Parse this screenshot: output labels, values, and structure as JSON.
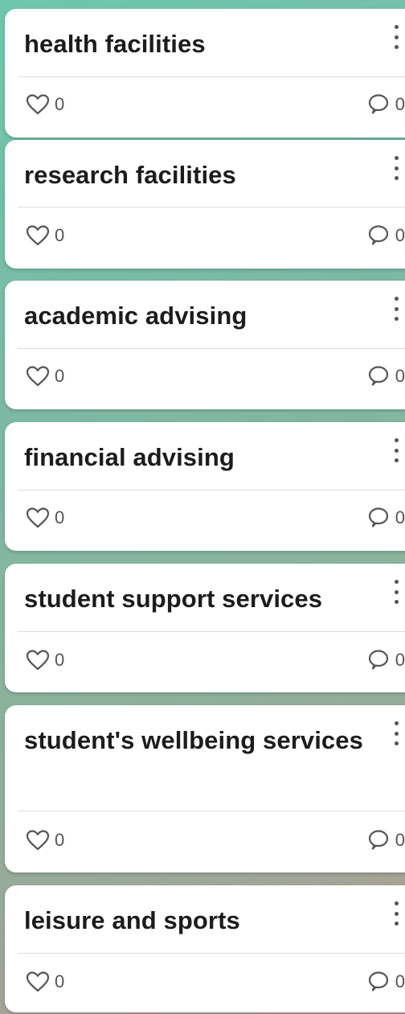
{
  "cards": [
    {
      "title": "health facilities",
      "likes": "0",
      "comments": "0"
    },
    {
      "title": "research facilities",
      "likes": "0",
      "comments": "0"
    },
    {
      "title": "academic advising",
      "likes": "0",
      "comments": "0"
    },
    {
      "title": "financial advising",
      "likes": "0",
      "comments": "0"
    },
    {
      "title": "student support services",
      "likes": "0",
      "comments": "0"
    },
    {
      "title": "student's wellbeing services",
      "likes": "0",
      "comments": "0"
    },
    {
      "title": "leisure and sports",
      "likes": "0",
      "comments": "0"
    }
  ],
  "icons": {
    "like": "heart-outline-icon",
    "comment": "speech-bubble-icon",
    "menu": "more-vertical-icon"
  },
  "colors": {
    "background_start": "#6ec6ad",
    "background_end": "#b69a92",
    "card": "#ffffff",
    "text": "#1c1c1c",
    "icon": "#555555"
  }
}
